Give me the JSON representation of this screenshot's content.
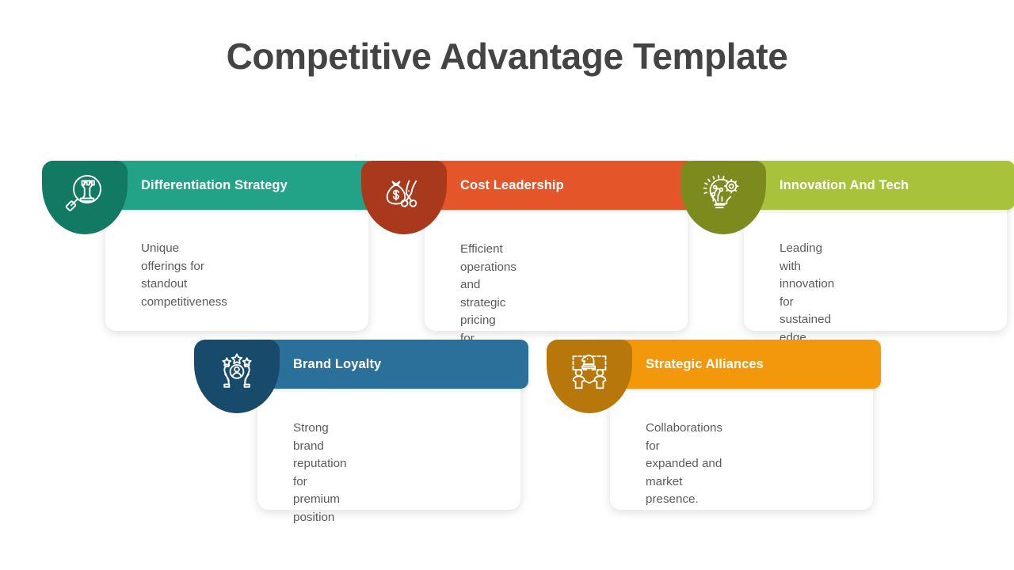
{
  "slide": {
    "title": "Competitive Advantage Template",
    "background_color": "#ffffff",
    "title_color": "#444444"
  },
  "cards": [
    {
      "id": "differentiation-strategy",
      "title": "Differentiation Strategy",
      "text": "Unique offerings for\nstandout competitiveness",
      "icon": "magnifier-chess-rook-icon",
      "shield_color": "#127A63",
      "header_color": "#22A287"
    },
    {
      "id": "cost-leadership",
      "title": "Cost Leadership",
      "text": "Efficient operations\nand strategic pricing\nfor advantage.",
      "icon": "money-bag-scissors-icon",
      "shield_color": "#A8391C",
      "header_color": "#E4562A"
    },
    {
      "id": "innovation-and-tech",
      "title": "Innovation And Tech",
      "text": "Leading with innovation\nfor sustained edge",
      "icon": "lightbulb-gear-icon",
      "shield_color": "#7D8B1E",
      "header_color": "#A9C23B"
    },
    {
      "id": "brand-loyalty",
      "title": "Brand Loyalty",
      "text": "Strong brand\nreputation for\npremium position",
      "icon": "hands-person-stars-icon",
      "shield_color": "#174A6B",
      "header_color": "#2B6F9B"
    },
    {
      "id": "strategic-alliances",
      "title": "Strategic Alliances",
      "text": "Collaborations for\nexpanded and market\npresence.",
      "icon": "people-chess-knight-icon",
      "shield_color": "#B7770B",
      "header_color": "#F3980B"
    }
  ]
}
